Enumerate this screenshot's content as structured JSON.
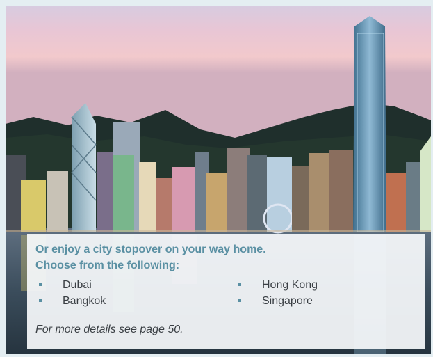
{
  "stopover": {
    "heading_line1": "Or enjoy a city stopover on your way home.",
    "heading_line2": "Choose from the following:",
    "cities_left": [
      "Dubai",
      "Bangkok"
    ],
    "cities_right": [
      "Hong Kong",
      "Singapore"
    ],
    "note": "For more details see page 50."
  },
  "colors": {
    "accent": "#5a90a3",
    "text": "#3a3f44",
    "page_background": "#e4eef2"
  }
}
